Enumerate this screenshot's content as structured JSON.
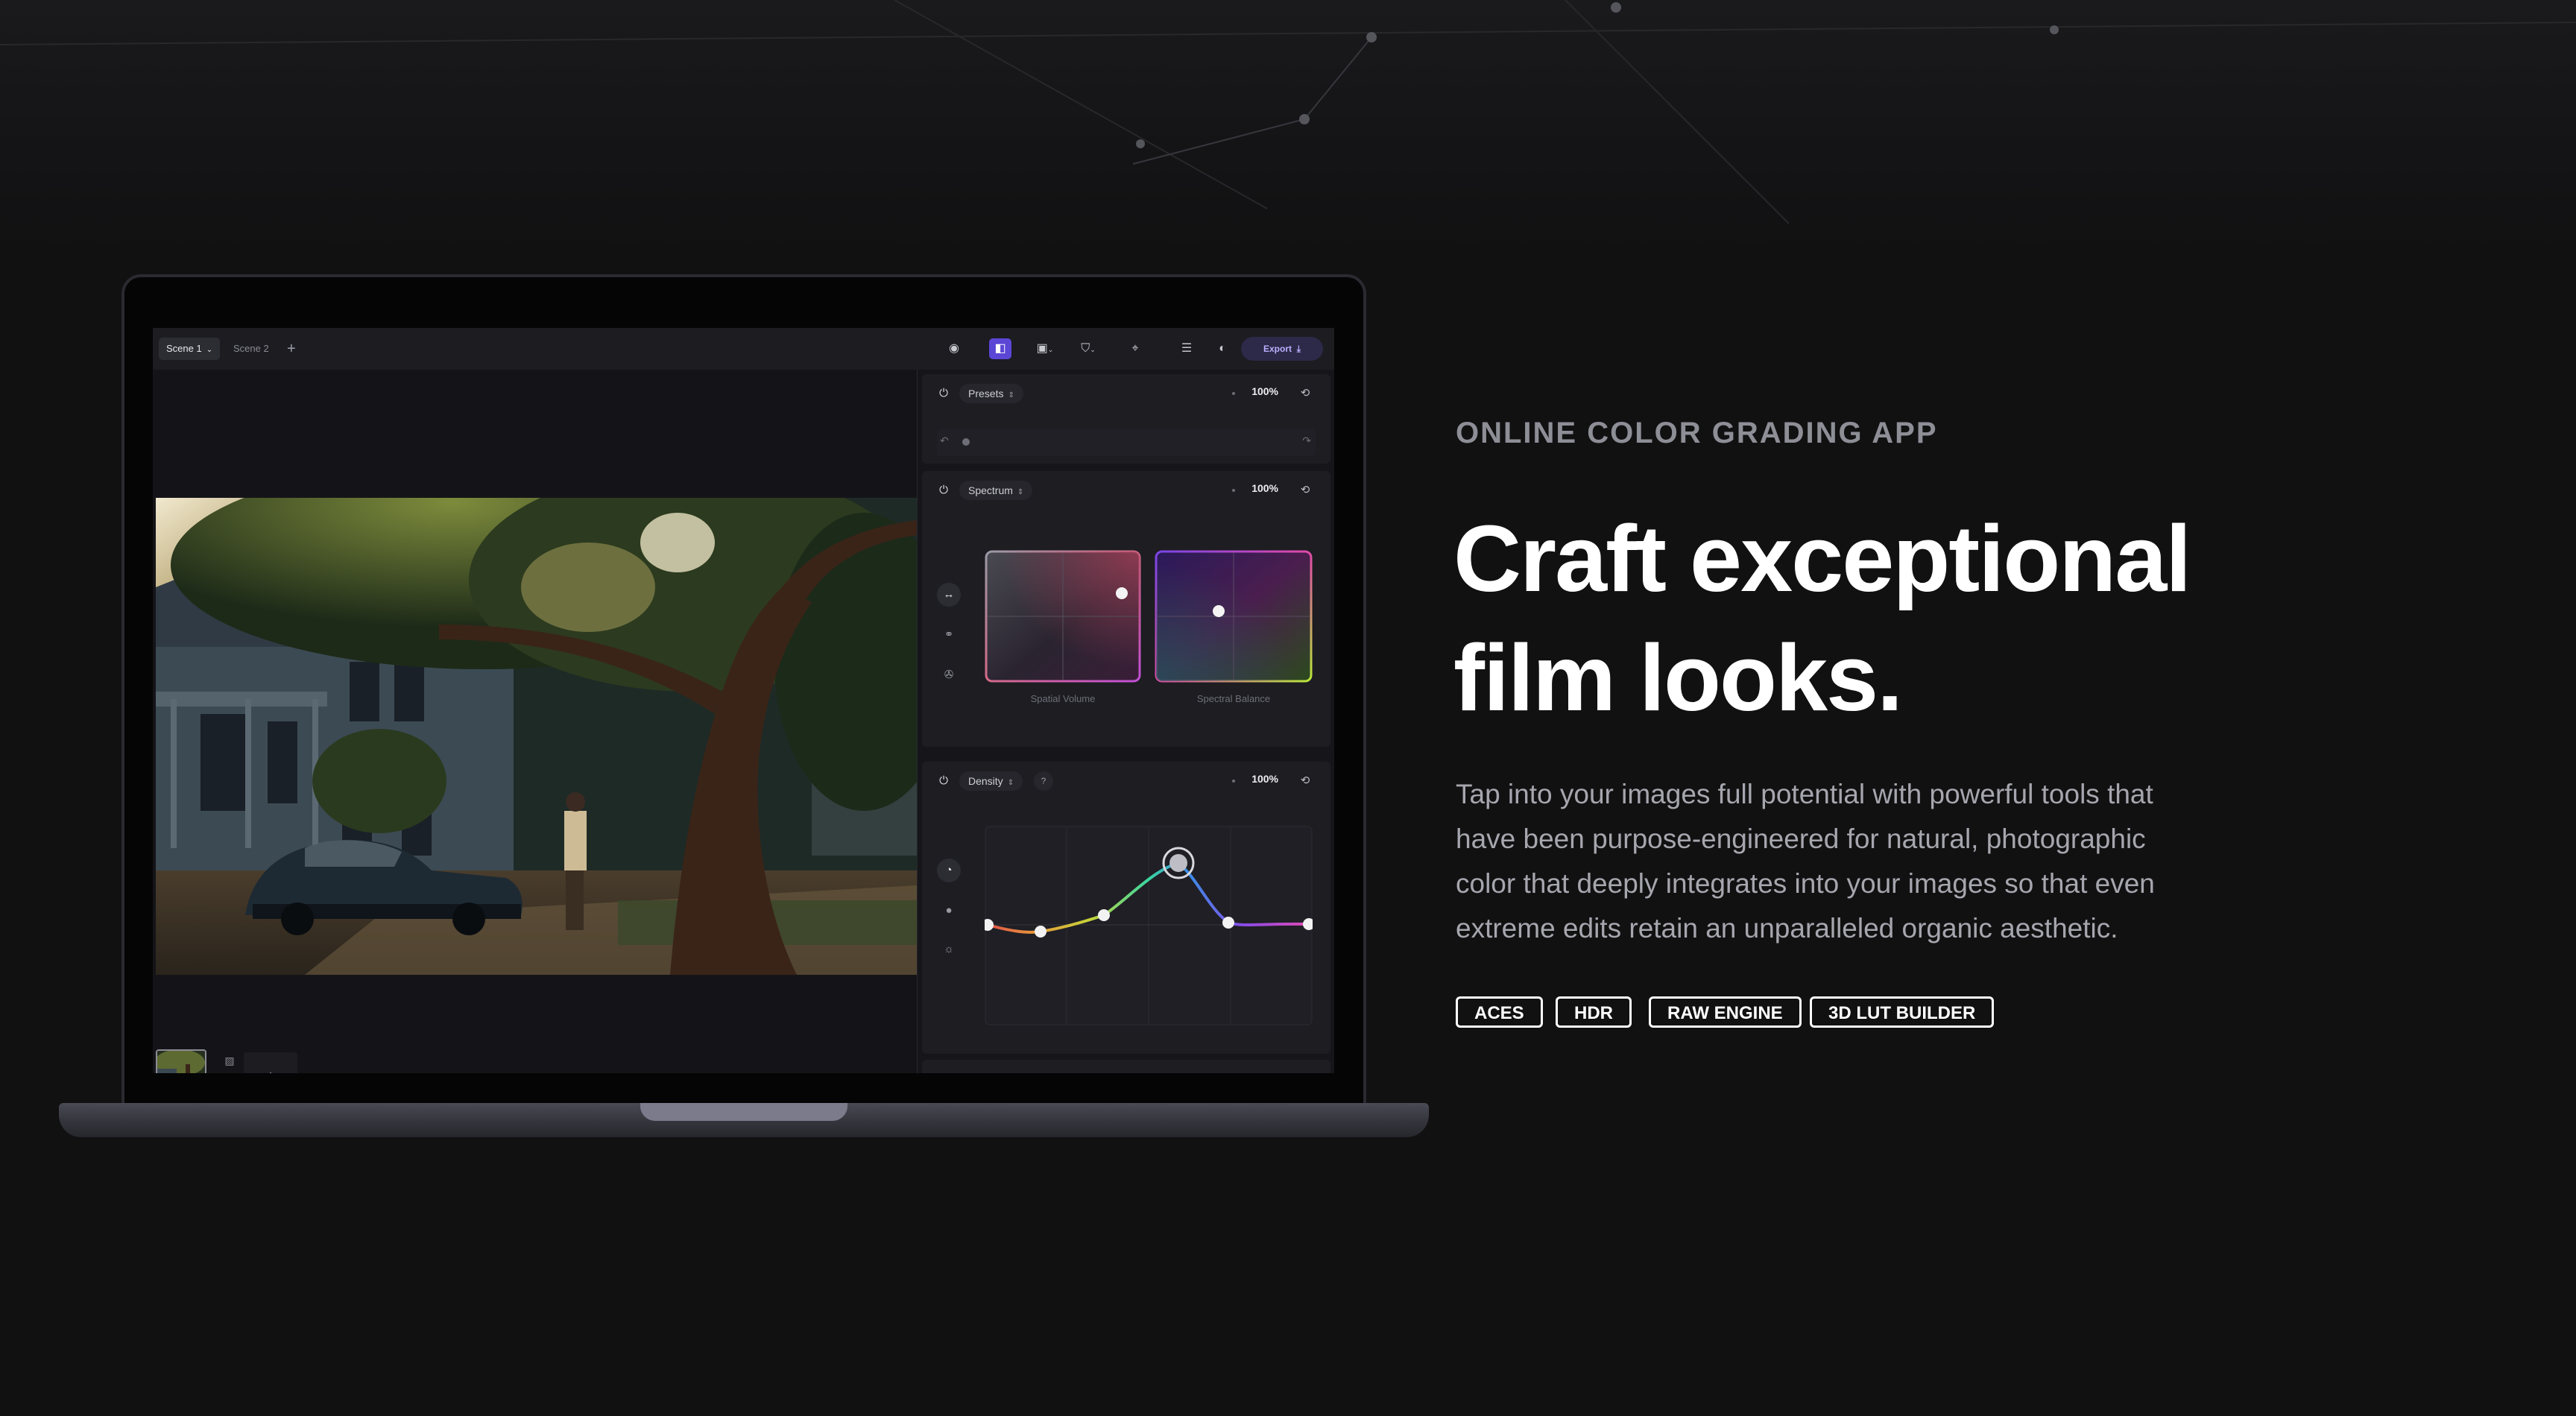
{
  "app": {
    "tabs": [
      {
        "label": "Scene 1",
        "active": true
      },
      {
        "label": "Scene 2",
        "active": false
      }
    ],
    "add_tab_label": "+",
    "toolbar_icons": [
      "sphere-icon",
      "compare-icon",
      "snapshot-icon",
      "mask-icon",
      "focus-icon",
      "menu-icon",
      "contrast-icon"
    ],
    "export_label": "Export",
    "filmstrip_add_label": "+",
    "panels": {
      "presets": {
        "title": "Presets",
        "percent": "100%"
      },
      "spectrum": {
        "title": "Spectrum",
        "percent": "100%",
        "pad_left_label": "Spatial Volume",
        "pad_right_label": "Spectral Balance"
      },
      "density": {
        "title": "Density",
        "percent": "100%",
        "help_label": "?"
      }
    }
  },
  "hero": {
    "eyebrow": "ONLINE COLOR GRADING APP",
    "headline_line1": "Craft exceptional",
    "headline_line2": "film looks.",
    "body": "Tap into your images full potential with powerful tools that have been purpose-engineered for natural, photographic color that deeply integrates into your images so that even extreme edits retain an unparalleled organic aesthetic.",
    "tags": [
      "ACES",
      "HDR",
      "RAW ENGINE",
      "3D LUT BUILDER"
    ]
  },
  "colors": {
    "background": "#111112",
    "accent": "#5b46d6",
    "export_bg": "#2d2948",
    "tag_border": "#ffffff",
    "muted_text": "#a6a6ae"
  }
}
